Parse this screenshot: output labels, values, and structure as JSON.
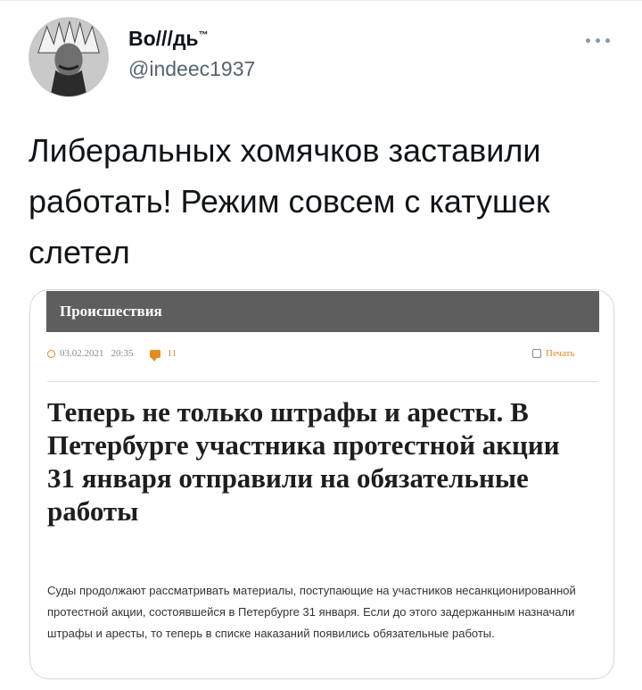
{
  "tweet": {
    "display_name": "Во///дь",
    "trademark": "™",
    "handle": "@indeec1937",
    "text": "Либеральных хомячков заставили работать! Режим совсем с катушек слетел",
    "more_icon": "more-horizontal-icon"
  },
  "article_card": {
    "section": "Происшествия",
    "date": "03.02.2021",
    "time": "20:35",
    "comment_count": "11",
    "print_label": "Печать",
    "headline": "Теперь не только штрафы и аресты. В Петербурге участника протестной акции 31 января отправили на обязательные работы",
    "lead": "Суды продолжают рассматривать материалы, поступающие на участников несанкционированной протестной акции, состоявшейся в Петербурге 31 января. Если до этого задержанным назначали штрафы и аресты, то теперь в списке наказаний появились обязательные работы.",
    "accent_color": "#e38b1e",
    "section_bar_color": "#5e5e5e"
  }
}
